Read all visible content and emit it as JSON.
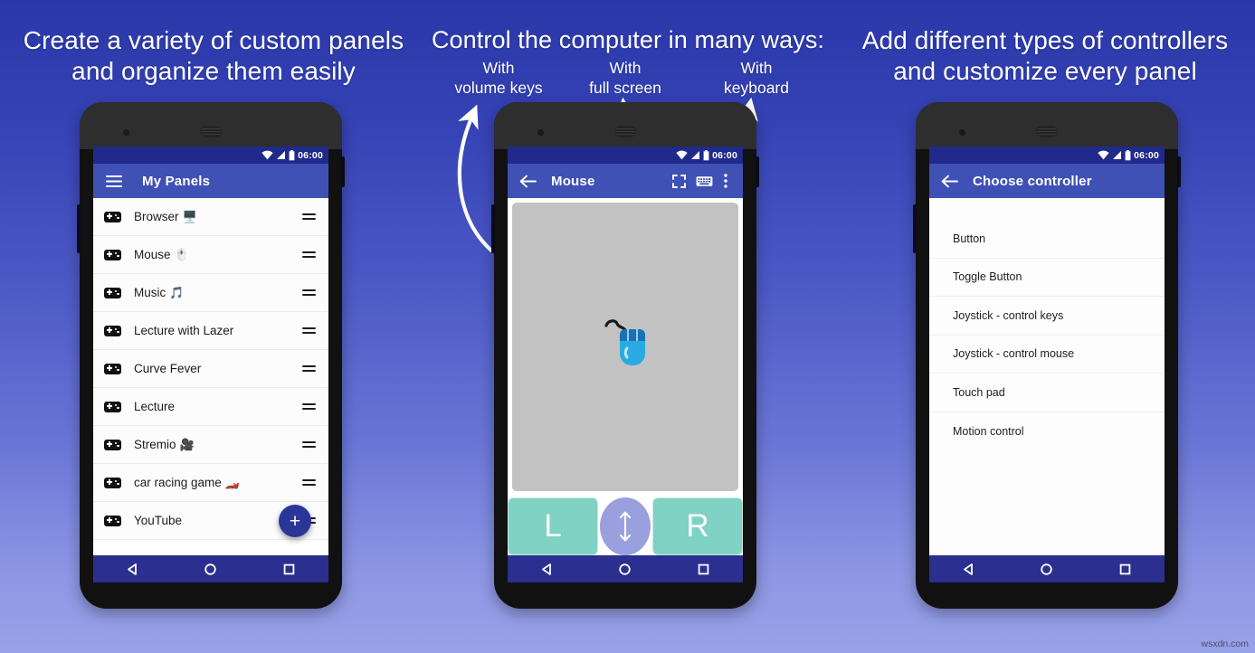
{
  "background": {
    "top_color": "#2b37a8",
    "bottom_color": "#98a2e8",
    "accent": "#3f51b5"
  },
  "headlines": {
    "left": "Create a variety of custom panels\nand organize them easily",
    "left_line1": "Create a variety of custom panels",
    "left_line2": "and organize them easily",
    "middle": "Control the computer in many ways:",
    "right_line1": "Add different types of controllers",
    "right_line2": "and customize every panel"
  },
  "sublabels": [
    {
      "line1": "With",
      "line2": "volume keys"
    },
    {
      "line1": "With",
      "line2": "full screen"
    },
    {
      "line1": "With",
      "line2": "keyboard"
    }
  ],
  "status_bar": {
    "time": "06:00",
    "icons": [
      "wifi-icon",
      "signal-icon",
      "battery-icon"
    ]
  },
  "nav_bar": {
    "back": "back-triangle-icon",
    "home": "home-circle-icon",
    "recents": "recents-square-icon"
  },
  "phone_one": {
    "appbar": {
      "menu_icon": "hamburger-menu-icon",
      "title": "My Panels"
    },
    "fab_label": "+",
    "rows": [
      {
        "label": "Browser",
        "emoji": "🖥️"
      },
      {
        "label": "Mouse",
        "emoji": "🖱️"
      },
      {
        "label": "Music",
        "emoji": "🎵"
      },
      {
        "label": "Lecture with Lazer",
        "emoji": ""
      },
      {
        "label": "Curve Fever",
        "emoji": ""
      },
      {
        "label": "Lecture",
        "emoji": ""
      },
      {
        "label": "Stremio",
        "emoji": "🎥"
      },
      {
        "label": "car racing game",
        "emoji": "🏎️"
      },
      {
        "label": "YouTube",
        "emoji": ""
      }
    ]
  },
  "phone_two": {
    "appbar": {
      "back_icon": "back-arrow-icon",
      "title": "Mouse",
      "fullscreen_icon": "fullscreen-icon",
      "keyboard_icon": "keyboard-icon",
      "overflow_icon": "overflow-menu-icon"
    },
    "touchpad_name": "touchpad-area",
    "buttons": {
      "left": "L",
      "right": "R",
      "scroll_icon": "scroll-updown-icon"
    },
    "colors": {
      "touchpad": "#c2c2c2",
      "lr_button": "#7fd2c4",
      "scroll": "#9aa0de"
    }
  },
  "phone_three": {
    "appbar": {
      "back_icon": "back-arrow-icon",
      "title": "Choose controller"
    },
    "options": [
      "Button",
      "Toggle Button",
      "Joystick - control keys",
      "Joystick - control mouse",
      "Touch pad",
      "Motion control"
    ]
  },
  "watermark": "wsxdn.com"
}
